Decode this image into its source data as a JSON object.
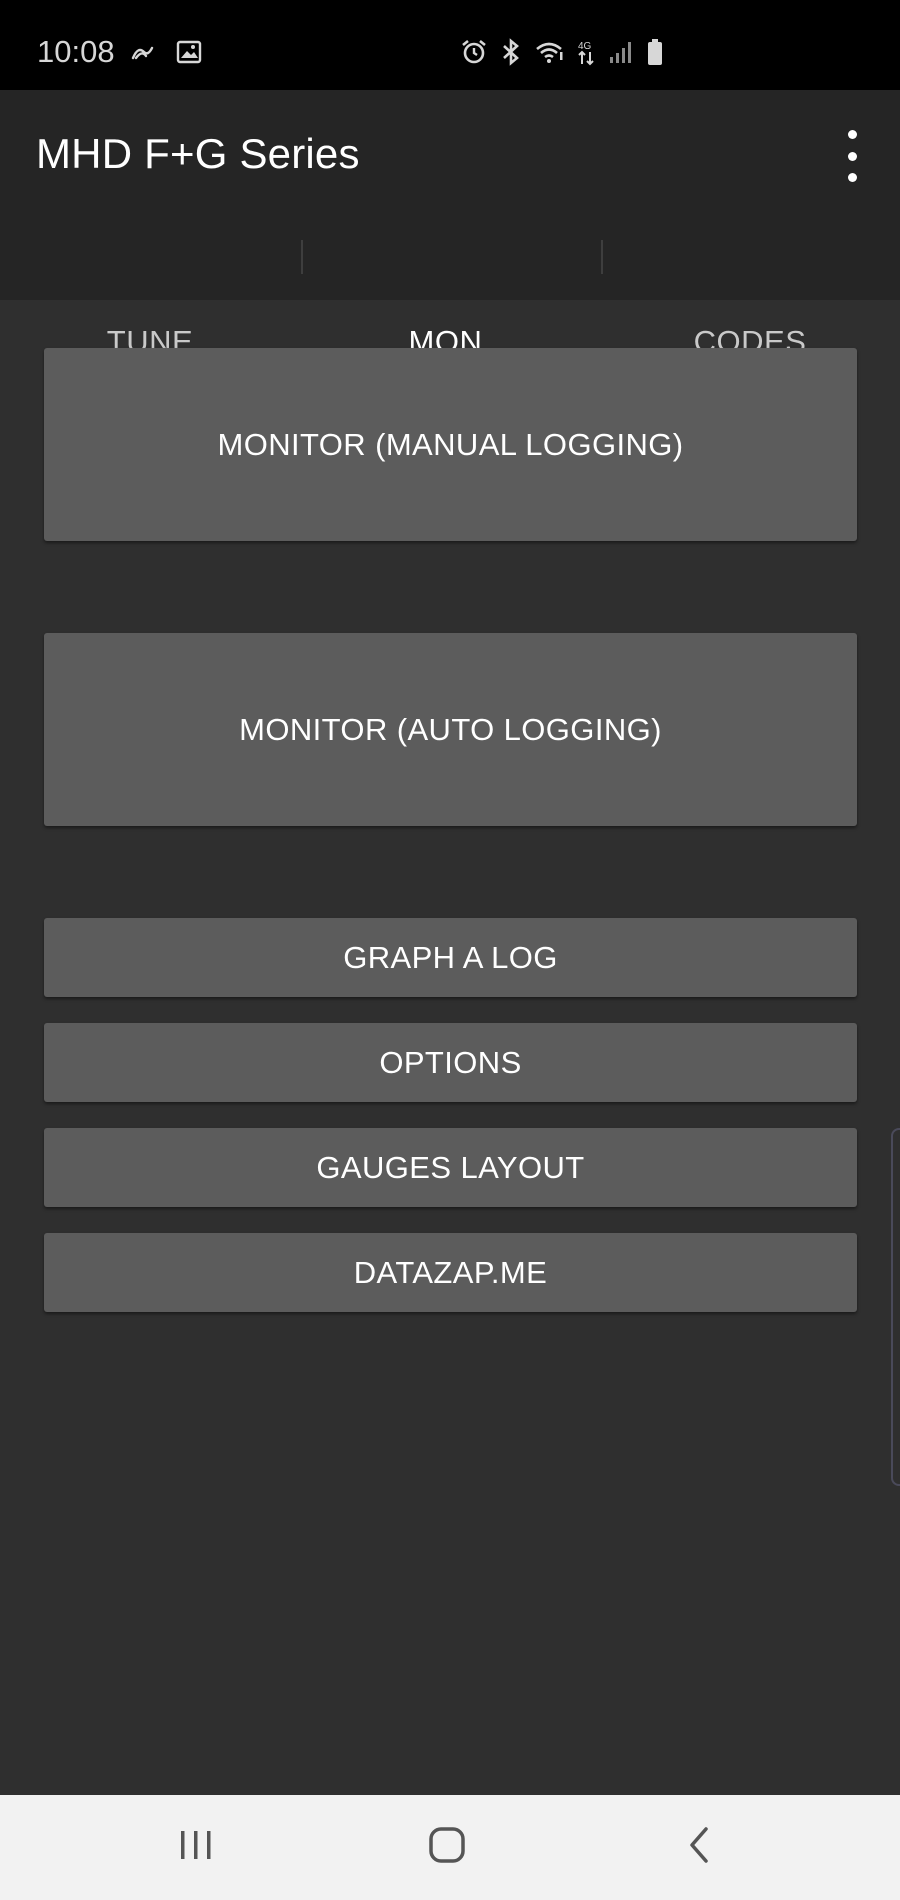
{
  "status_bar": {
    "time": "10:08",
    "left_icons": [
      "edge-lighting-icon",
      "image-icon"
    ],
    "right_icons": [
      "alarm-icon",
      "bluetooth-icon",
      "wifi-icon",
      "4g-data-icon",
      "signal-icon",
      "battery-icon"
    ]
  },
  "app_bar": {
    "title": "MHD F+G Series",
    "menu_icon": "more-vert-icon"
  },
  "tabs": [
    {
      "label": "TUNE",
      "active": false
    },
    {
      "label": "MON.",
      "active": true
    },
    {
      "label": "CODES",
      "active": false
    }
  ],
  "buttons": {
    "monitor_manual": "MONITOR (MANUAL LOGGING)",
    "monitor_auto": "MONITOR (AUTO LOGGING)",
    "graph_log": "GRAPH A LOG",
    "options": "OPTIONS",
    "gauges_layout": "GAUGES LAYOUT",
    "datazap": "DATAZAP.ME"
  },
  "nav_bar": {
    "icons": [
      "recent-apps-icon",
      "home-icon",
      "back-icon"
    ]
  },
  "colors": {
    "background": "#2f2f2f",
    "app_bar": "#252525",
    "button": "#5c5c5c",
    "tab_indicator": "#7fcfc7",
    "status_bar": "#000000",
    "nav_bar": "#f2f2f2"
  }
}
